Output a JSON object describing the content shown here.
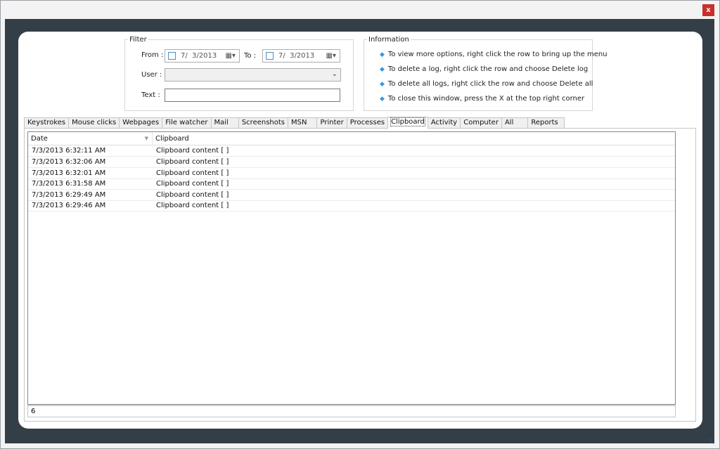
{
  "window": {
    "close_label": "x"
  },
  "filter": {
    "legend": "Filter",
    "from_label": "From :",
    "from_value": "7/  3/2013",
    "to_label": "To :",
    "to_value": "7/  3/2013",
    "user_label": "User :",
    "user_value": "",
    "text_label": "Text :",
    "text_value": ""
  },
  "information": {
    "legend": "Information",
    "bullet": "◆",
    "lines": [
      "To view more options, right click the row to bring up the menu",
      "To delete a log, right click the row and choose Delete log",
      "To delete all logs, right click the row and choose Delete all",
      "To close this window, press the X at the top right corner"
    ]
  },
  "tabs": [
    {
      "label": "Keystrokes"
    },
    {
      "label": "Mouse clicks"
    },
    {
      "label": "Webpages"
    },
    {
      "label": "File watcher"
    },
    {
      "label": "Mail"
    },
    {
      "label": "Screenshots"
    },
    {
      "label": "MSN"
    },
    {
      "label": "Printer"
    },
    {
      "label": "Processes"
    },
    {
      "label": "Clipboard"
    },
    {
      "label": "Activity"
    },
    {
      "label": "Computer"
    },
    {
      "label": "All"
    },
    {
      "label": "Reports"
    }
  ],
  "active_tab": "Clipboard",
  "table": {
    "columns": [
      "Date",
      "Clipboard"
    ],
    "rows": [
      [
        "7/3/2013 6:32:11 AM",
        "Clipboard content [  ]"
      ],
      [
        "7/3/2013 6:32:06 AM",
        "Clipboard content [  ]"
      ],
      [
        "7/3/2013 6:32:01 AM",
        "Clipboard content [  ]"
      ],
      [
        "7/3/2013 6:31:58 AM",
        "Clipboard content [  ]"
      ],
      [
        "7/3/2013 6:29:49 AM",
        "Clipboard content [  ]"
      ],
      [
        "7/3/2013 6:29:46 AM",
        "Clipboard content [  ]"
      ]
    ]
  },
  "status": {
    "count": "6"
  },
  "icons": {
    "calendar": "calendar-icon",
    "dropdown": "chevron-down-icon",
    "sort": "sort-down-icon",
    "grip": "resize-grip-icon"
  }
}
